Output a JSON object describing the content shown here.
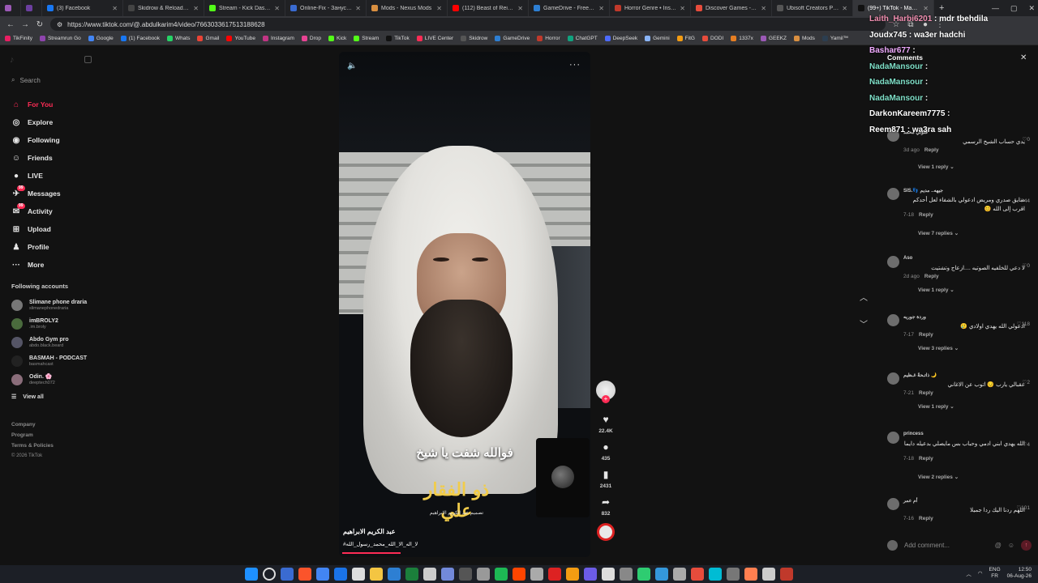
{
  "browser": {
    "tabs": [
      {
        "title": "",
        "color": "#9b59b6"
      },
      {
        "title": "",
        "color": "#6c3fa0"
      },
      {
        "title": "(3) Facebook",
        "color": "#1877f2"
      },
      {
        "title": "Skidrow & Reloaded Games",
        "color": "#444"
      },
      {
        "title": "Stream - Kick Dashboard",
        "color": "#53fc18"
      },
      {
        "title": "Online-Fix - Занусk игр по сети",
        "color": "#3a6bd1"
      },
      {
        "title": "Mods - Nexus Mods",
        "color": "#d98f40"
      },
      {
        "title": "(112) Beast of Reincarnation",
        "color": "#ff0000"
      },
      {
        "title": "GameDrive - Free Download",
        "color": "#2d7fd3"
      },
      {
        "title": "Horror Genre • Install Guide",
        "color": "#c0392b"
      },
      {
        "title": "Discover Games - Keymailer",
        "color": "#e74c3c"
      },
      {
        "title": "Ubisoft Creators Program",
        "color": "#555"
      },
      {
        "title": "(99+) TikTok - Make Your Day",
        "color": "#111"
      }
    ],
    "new_tab": "+",
    "url": "https://www.tiktok.com/@.abdulkarim4/video/7663033617513188628",
    "bookmarks": [
      {
        "label": "TikFinity",
        "color": "#e91e63"
      },
      {
        "label": "Streamrun Go",
        "color": "#8e44ad"
      },
      {
        "label": "Google",
        "color": "#4285f4"
      },
      {
        "label": "(1) Facebook",
        "color": "#1877f2"
      },
      {
        "label": "Whats",
        "color": "#25d366"
      },
      {
        "label": "Gmail",
        "color": "#ea4335"
      },
      {
        "label": "YouTube",
        "color": "#ff0000"
      },
      {
        "label": "Instagram",
        "color": "#c13584"
      },
      {
        "label": "Drop",
        "color": "#e84393"
      },
      {
        "label": "Kick",
        "color": "#53fc18"
      },
      {
        "label": "Stream",
        "color": "#53fc18"
      },
      {
        "label": "TikTok",
        "color": "#111"
      },
      {
        "label": "LIVE Center",
        "color": "#fe2c55"
      },
      {
        "label": "Skidrow",
        "color": "#555"
      },
      {
        "label": "GameDrive",
        "color": "#2d7fd3"
      },
      {
        "label": "Horror",
        "color": "#c0392b"
      },
      {
        "label": "ChatGPT",
        "color": "#10a37f"
      },
      {
        "label": "DeepSeek",
        "color": "#4d6bfe"
      },
      {
        "label": "Gemini",
        "color": "#8ab4f8"
      },
      {
        "label": "FitG",
        "color": "#f39c12"
      },
      {
        "label": "DODI",
        "color": "#e74c3c"
      },
      {
        "label": "1337x",
        "color": "#e67e22"
      },
      {
        "label": "GEEKZ",
        "color": "#9b59b6"
      },
      {
        "label": "Mods",
        "color": "#d98f40"
      },
      {
        "label": "Yamil™",
        "color": "#2c3e50"
      }
    ]
  },
  "tiktok": {
    "search_placeholder": "Search",
    "nav": [
      {
        "label": "For You",
        "icon": "home-icon",
        "glyph": "⌂",
        "active": true,
        "badge": ""
      },
      {
        "label": "Explore",
        "icon": "compass-icon",
        "glyph": "◎",
        "active": false,
        "badge": ""
      },
      {
        "label": "Following",
        "icon": "following-icon",
        "glyph": "◉",
        "active": false,
        "badge": ""
      },
      {
        "label": "Friends",
        "icon": "friends-icon",
        "glyph": "☺",
        "active": false,
        "badge": ""
      },
      {
        "label": "LIVE",
        "icon": "live-icon",
        "glyph": "●",
        "active": false,
        "badge": ""
      },
      {
        "label": "Messages",
        "icon": "messages-icon",
        "glyph": "✈",
        "active": false,
        "badge": "99"
      },
      {
        "label": "Activity",
        "icon": "activity-icon",
        "glyph": "✉",
        "active": false,
        "badge": "99"
      },
      {
        "label": "Upload",
        "icon": "upload-icon",
        "glyph": "⊞",
        "active": false,
        "badge": ""
      },
      {
        "label": "Profile",
        "icon": "profile-icon",
        "glyph": "♟",
        "active": false,
        "badge": ""
      },
      {
        "label": "More",
        "icon": "more-icon",
        "glyph": "···",
        "active": false,
        "badge": ""
      }
    ],
    "following_heading": "Following accounts",
    "accounts": [
      {
        "name": "Slimane phone draria",
        "handle": "slimanephonedraria",
        "color": "#777"
      },
      {
        "name": "imBROLY2",
        "handle": ".im.broly",
        "color": "#4a6b3d"
      },
      {
        "name": "Abdo Gym pro",
        "handle": "abdo.black.beard",
        "color": "#556"
      },
      {
        "name": "BASMAH - PODCAST",
        "handle": "basmahcast",
        "color": "#222"
      },
      {
        "name": "Odin. 🌸",
        "handle": "deeptech072",
        "color": "#8a6d7a"
      }
    ],
    "view_all": "View all",
    "footer": {
      "company": "Company",
      "program": "Program",
      "terms": "Terms & Policies",
      "copyright": "© 2026 TikTok"
    }
  },
  "video": {
    "caption": "فوالله شفت يا شيخ",
    "signature": "ذو الفقار علي",
    "signature_sub": "تصميم عبد الكريم الابراهيم",
    "author": "عبد الكريم الابراهيم",
    "tags": "#لا_اله_الا_الله_محمد_رسول_الله",
    "progress_fraction": 0.24,
    "likes": "22.4K",
    "comments": "435",
    "saves": "2431",
    "shares": "832"
  },
  "stream_chat": [
    {
      "user": "Laith_Harbi6201",
      "msg": "mdr tbehdila",
      "cls": "u1"
    },
    {
      "user": "Joudx745",
      "msg": "wa3er hadchi",
      "cls": "u2"
    },
    {
      "user": "Bashar677",
      "msg": "",
      "cls": "u3"
    },
    {
      "user": "NadaMansour",
      "msg": "",
      "cls": "u4"
    },
    {
      "user": "NadaMansour",
      "msg": "",
      "cls": "u4"
    },
    {
      "user": "NadaMansour",
      "msg": "",
      "cls": "u4"
    },
    {
      "user": "DarkonKareem7775",
      "msg": "",
      "cls": "u2"
    },
    {
      "user": "Reem871",
      "msg": "wa3ra sah",
      "cls": "u2"
    }
  ],
  "comments_panel": {
    "title": "Comments",
    "add_placeholder": "Add comment...",
    "reply_label": "Reply",
    "items": [
      {
        "name": "فلوتي محمد",
        "text": "يدي حساب الشيخ الرسمي",
        "date": "3d ago",
        "likes": "0",
        "replies": "View 1 reply"
      },
      {
        "name": "SIS.👣 جيهه.. مديم",
        "text": "ضايق صدري ومريض ادعولي بالشفاء لعل أحدكم اقرب إلى الله 😊",
        "date": "7-18",
        "likes": "44",
        "replies": "View 7 replies"
      },
      {
        "name": "Aso",
        "text": "لا دعي للخلفيه الصوتيه ....ازعاج وتشتيت",
        "date": "2d ago",
        "likes": "0",
        "replies": "View 1 reply"
      },
      {
        "name": "وردة جوريه",
        "text": "ادعولي الله يهدي اولادي 🥲",
        "date": "7-17",
        "likes": "118",
        "replies": "View 3 replies"
      },
      {
        "name": "ذاتـحةٌ غـظيم 🌙",
        "text": "عقبالي يارب 😔 اتوب عن الاغاني",
        "date": "7-21",
        "likes": "2",
        "replies": "View 1 reply"
      },
      {
        "name": "princess",
        "text": "الله يهدي ابني ادمي وحباب بس مايصلي بدعيله دايما",
        "date": "7-18",
        "likes": "4",
        "replies": "View 2 replies"
      },
      {
        "name": "أم عمر",
        "text": "اللهم ردنا اليك ردا جميلا",
        "date": "7-16",
        "likes": "101",
        "replies": ""
      }
    ]
  },
  "taskbar": {
    "icon_colors": [
      "#1e90ff",
      "#eee",
      "#3a6bd1",
      "#fb542b",
      "#4285f4",
      "#1a73e8",
      "#ddd",
      "#f4c542",
      "#2d7fd3",
      "#1b7f3b",
      "#ccc",
      "#7289da",
      "#555",
      "#999",
      "#1db954",
      "#ff4500",
      "#aaa",
      "#d22",
      "#f39c12",
      "#6c5ce7",
      "#ddd",
      "#888",
      "#2ecc71",
      "#3498db",
      "#aaa",
      "#e74c3c",
      "#00bcd4",
      "#777",
      "#ff7f50",
      "#ccc",
      "#c0392b"
    ],
    "lang": "ENG",
    "lang2": "FR",
    "time": "12:50",
    "date": "06-Aug-26"
  }
}
